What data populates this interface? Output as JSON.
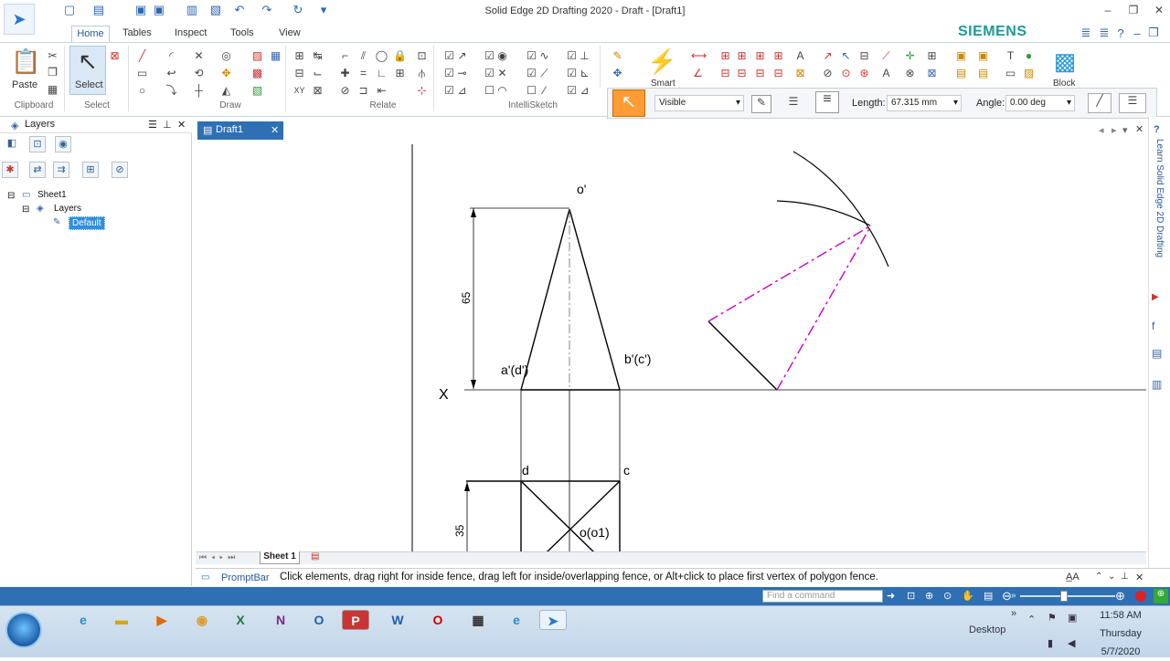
{
  "titlebar": {
    "title": "Solid Edge 2D Drafting 2020 - Draft - [Draft1]",
    "brand": "SIEMENS"
  },
  "ribbon": {
    "tabs": [
      "Home",
      "Tables",
      "Inspect",
      "Tools",
      "View"
    ],
    "active_tab": "Home",
    "groups": {
      "clipboard": "Clipboard",
      "select": "Select",
      "draw": "Draw",
      "relate": "Relate",
      "intellisketch": "IntelliSketch"
    },
    "paste_label": "Paste",
    "select_label": "Select",
    "smart_label": "Smart",
    "block_label": "Block"
  },
  "command_bar": {
    "line_style": "Visible",
    "length_label": "Length:",
    "length_value": "67.315 mm",
    "angle_label": "Angle:",
    "angle_value": "0.00 deg"
  },
  "layers_panel": {
    "title": "Layers",
    "tree": [
      "Sheet1",
      "Layers",
      "Default"
    ]
  },
  "document": {
    "tab_label": "Draft1",
    "sheet_tab": "Sheet 1"
  },
  "drawing_labels": {
    "o_prime": "o'",
    "a_prime": "a'(d')",
    "b_prime": "b'(c')",
    "x_axis": "X",
    "dim_65": "65",
    "dim_35": "35",
    "d": "d",
    "c": "c",
    "o1": "o(o1)"
  },
  "right_panel": {
    "label": "Learn Solid Edge 2D Drafting"
  },
  "prompt": {
    "label": "PromptBar",
    "message": "Click elements, drag right for inside fence, drag left for inside/overlapping fence, or Alt+click to place first vertex of polygon fence."
  },
  "status": {
    "find_placeholder": "Find a command"
  },
  "taskbar": {
    "desktop_label": "Desktop",
    "time": "11:58 AM",
    "day": "Thursday",
    "date": "5/7/2020"
  },
  "colors": {
    "accent": "#2f6fb4",
    "brand": "#1a9b95",
    "construction": "#cc00cc"
  }
}
